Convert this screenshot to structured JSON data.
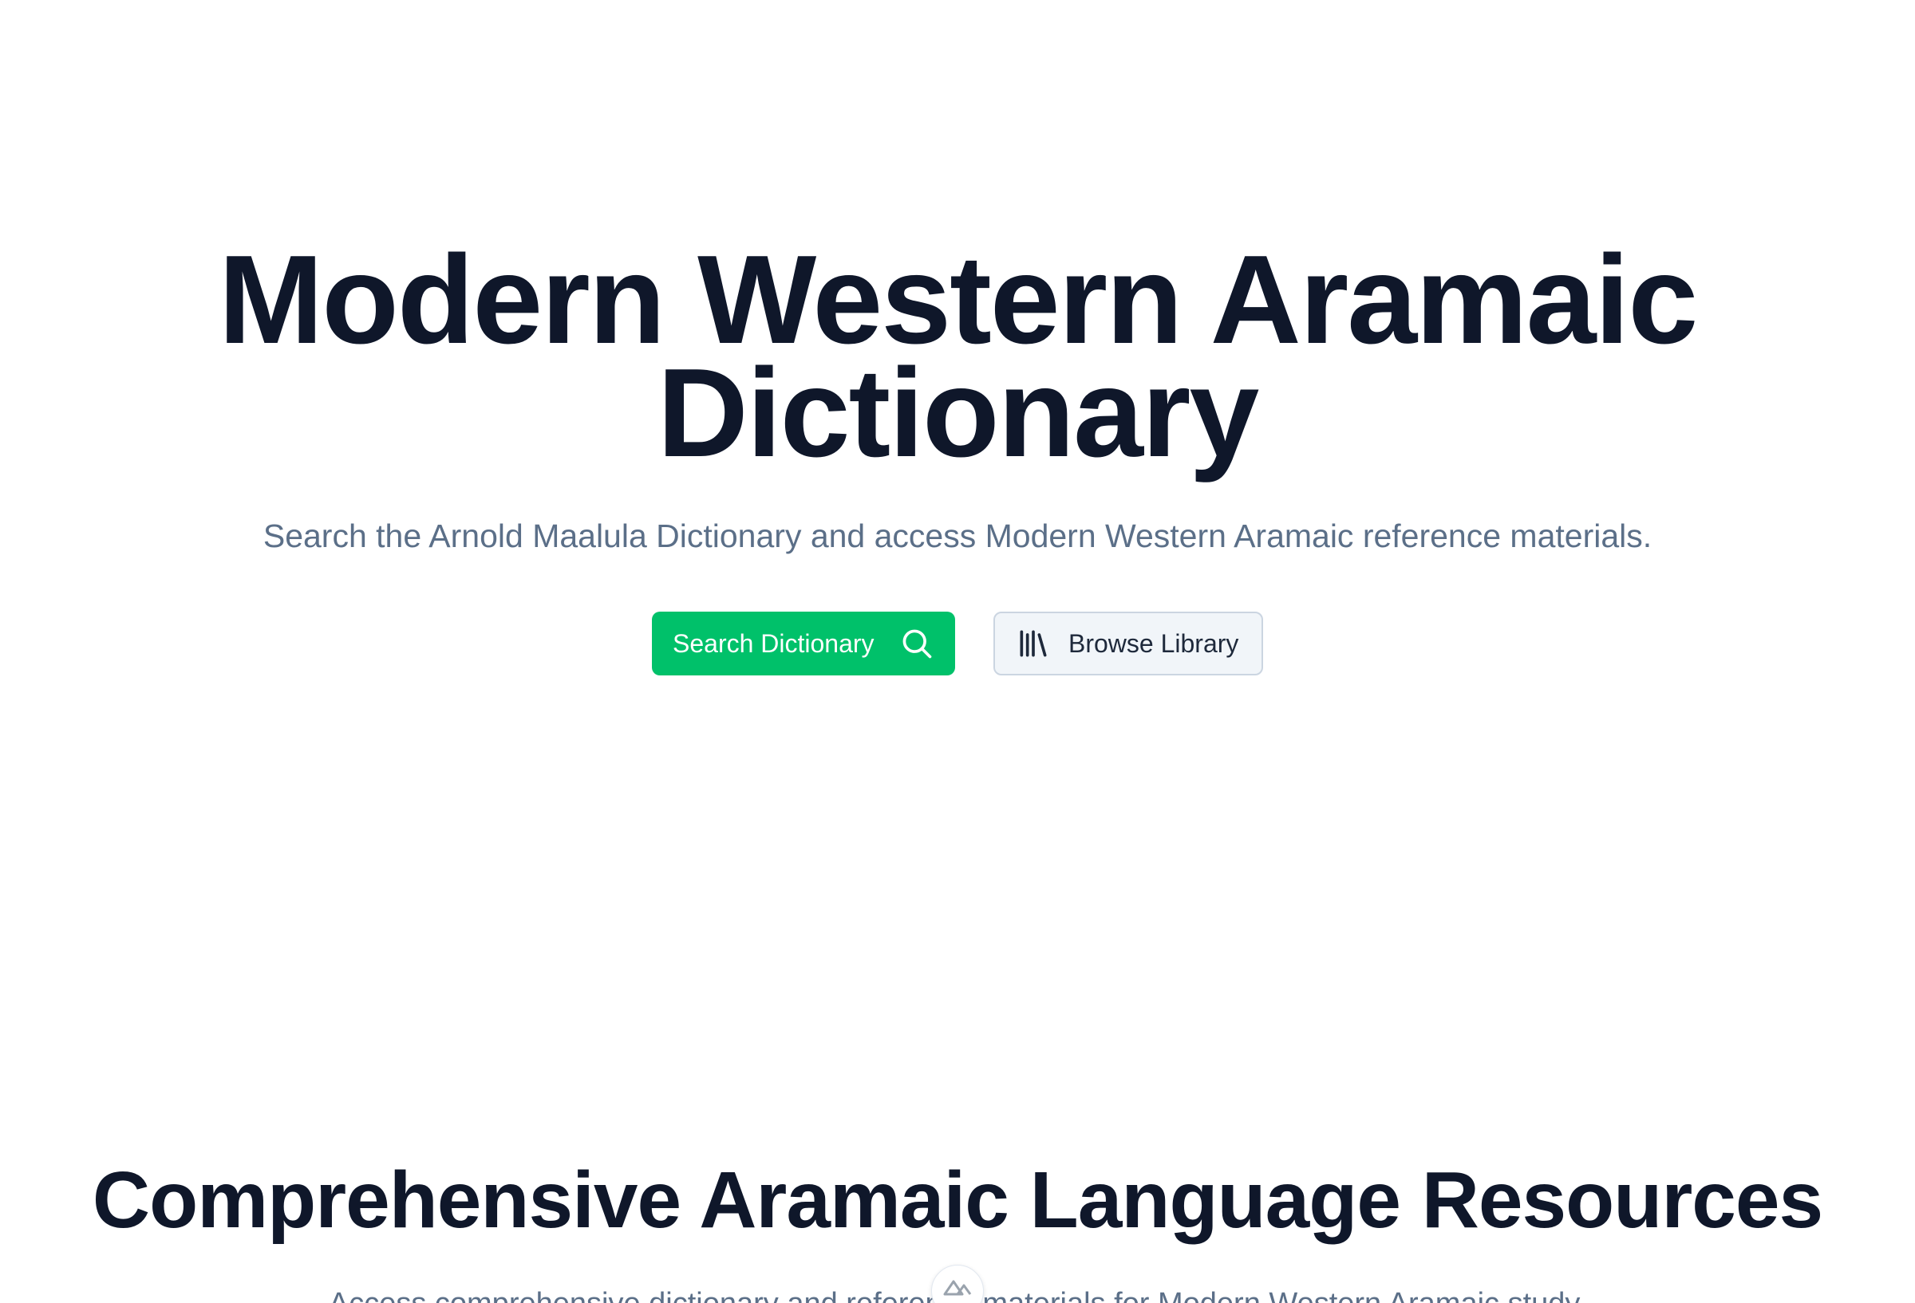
{
  "hero": {
    "title": "Modern Western Aramaic Dictionary",
    "subtitle": "Search the Arnold Maalula Dictionary and access Modern Western Aramaic reference materials.",
    "primary_button": {
      "label": "Search Dictionary",
      "icon": "search-icon"
    },
    "secondary_button": {
      "label": "Browse Library",
      "icon": "library-icon"
    }
  },
  "resources": {
    "title": "Comprehensive Aramaic Language Resources",
    "subtitle": "Access comprehensive dictionary and reference materials for Modern Western Aramaic study."
  },
  "floating_logo": {
    "icon": "mountain-logo-icon"
  },
  "colors": {
    "primary": "#00c16a",
    "heading": "#0f172a",
    "muted": "#5b6f88",
    "secondary_bg": "#f1f5f9",
    "secondary_border": "#cbd5e1"
  }
}
